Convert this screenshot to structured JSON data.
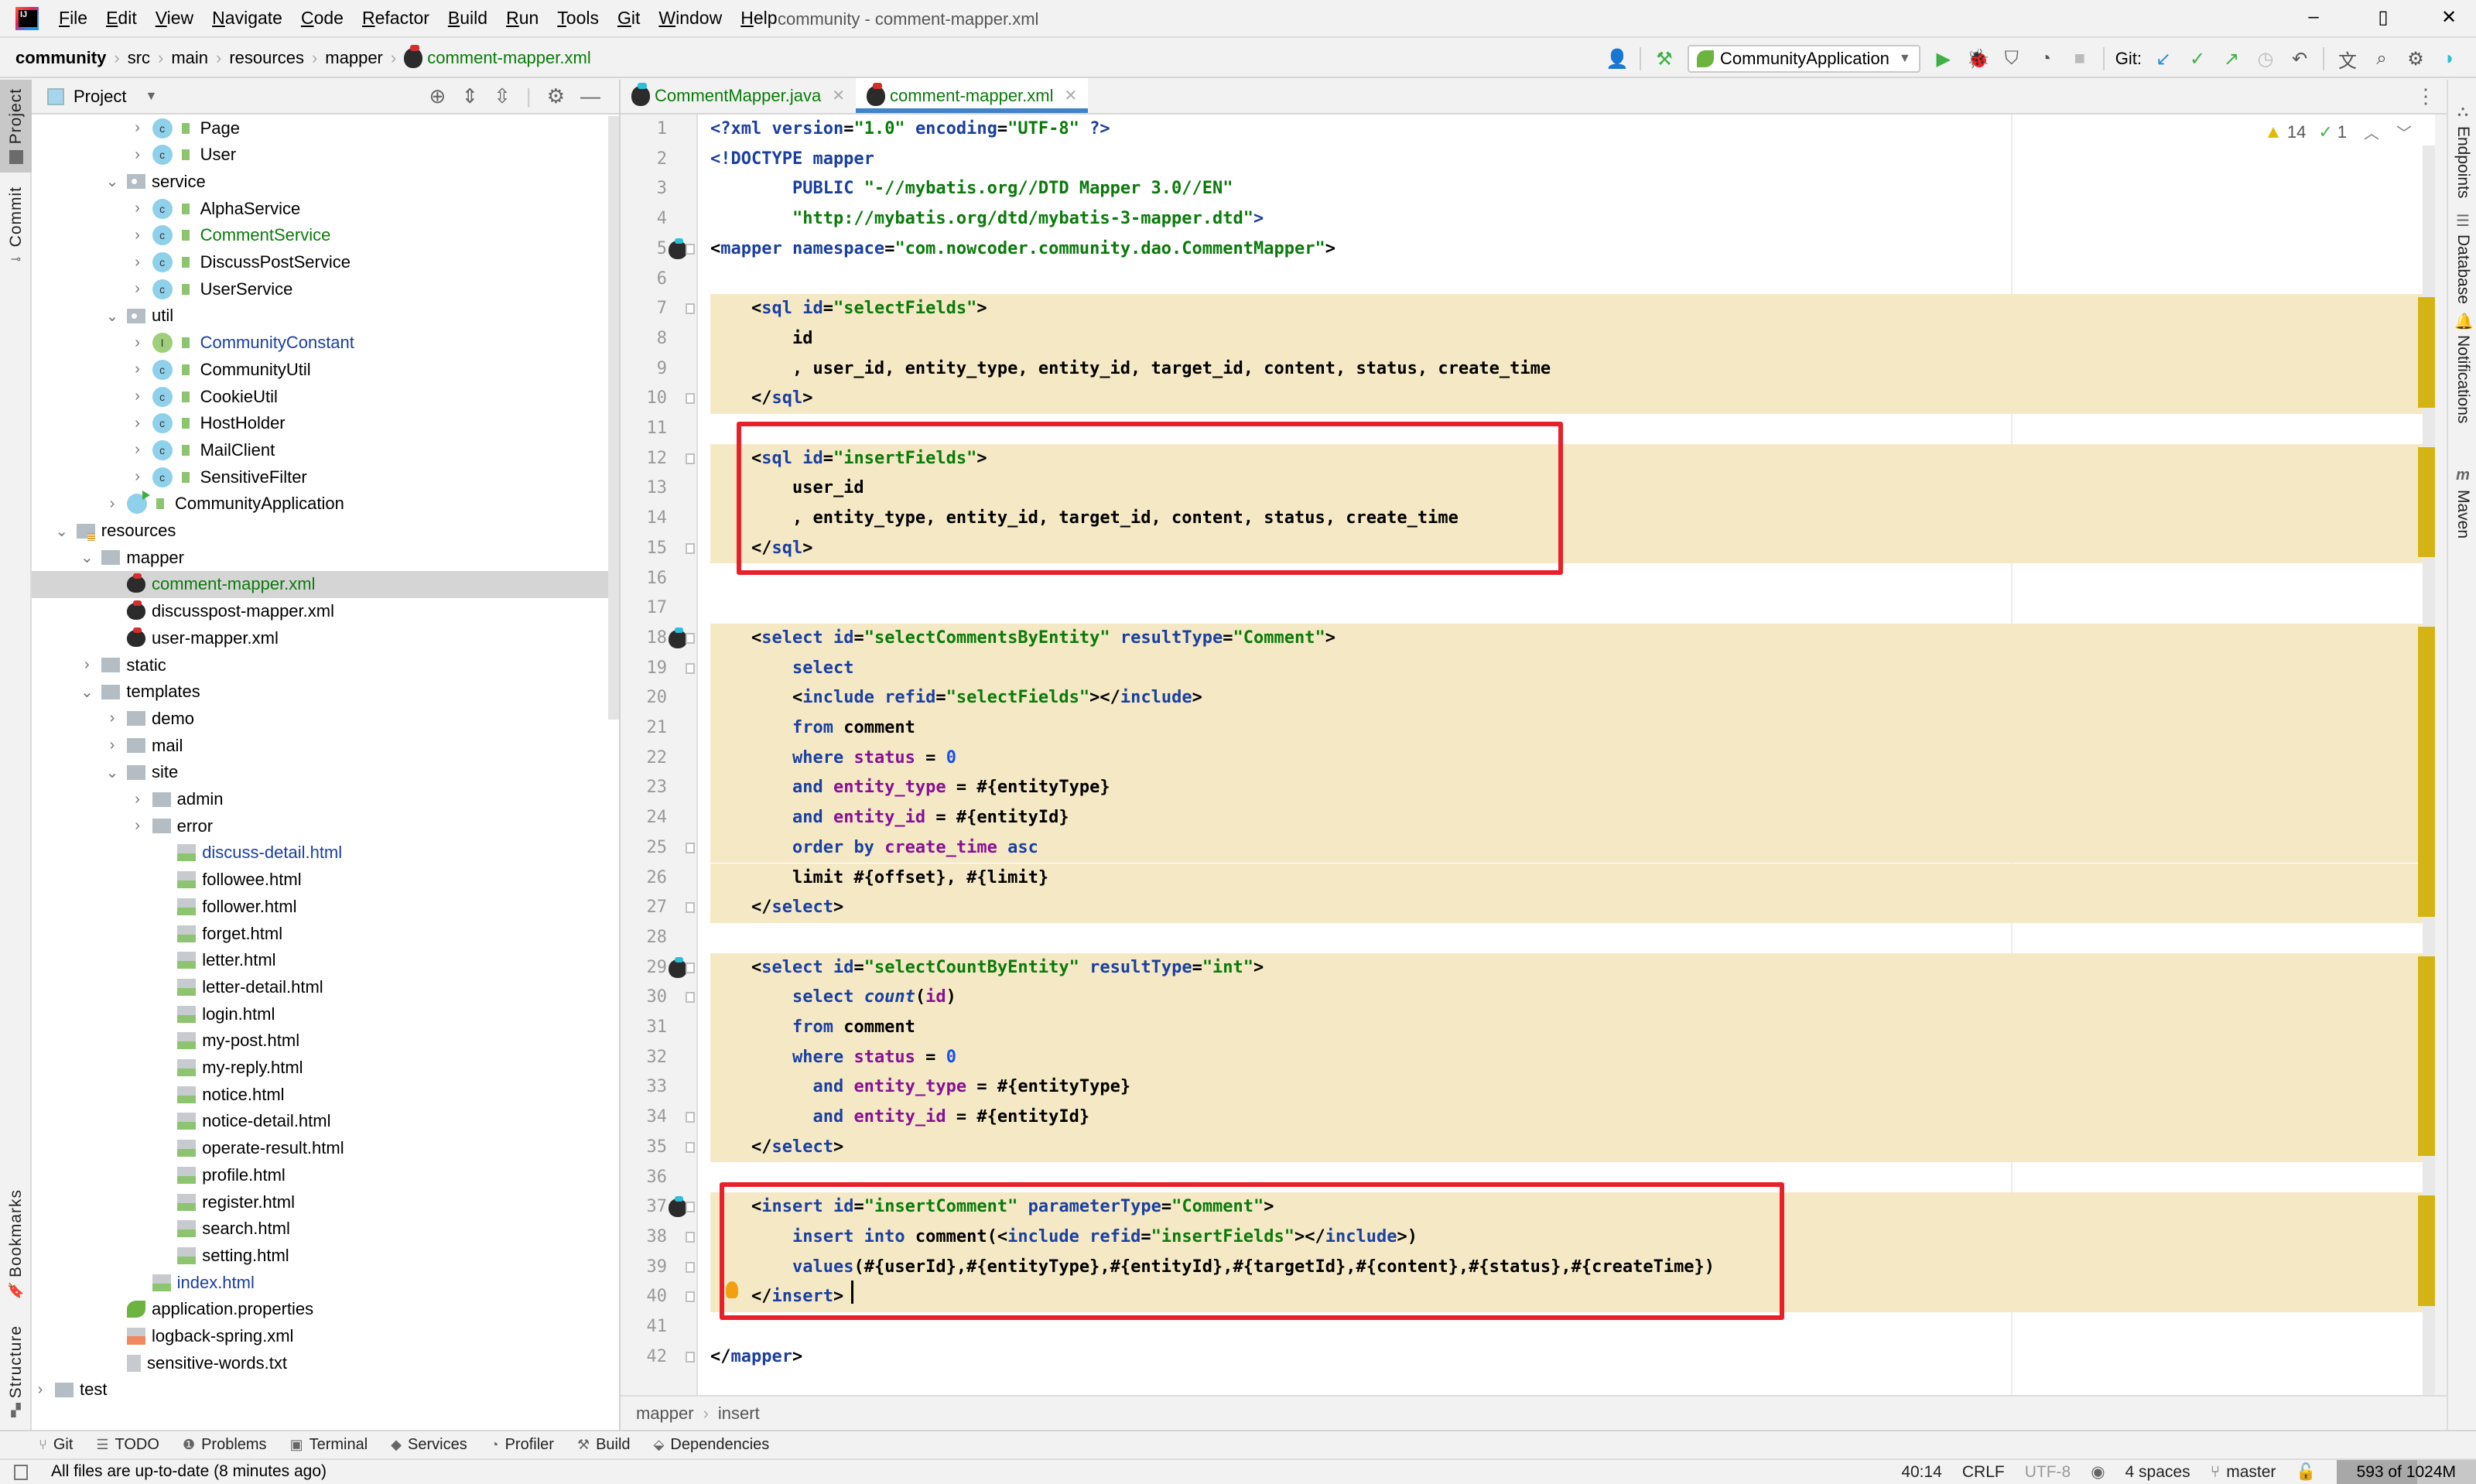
{
  "window": {
    "title": "community - comment-mapper.xml",
    "menu": [
      "File",
      "Edit",
      "View",
      "Navigate",
      "Code",
      "Refactor",
      "Build",
      "Run",
      "Tools",
      "Git",
      "Window",
      "Help"
    ],
    "controls": {
      "minimize": "–",
      "maximize": "▯",
      "close": "✕"
    }
  },
  "breadcrumb": [
    "community",
    "src",
    "main",
    "resources",
    "mapper",
    "comment-mapper.xml"
  ],
  "toolbar": {
    "run_config": "CommunityApplication",
    "git_label": "Git:"
  },
  "left_strip": {
    "tabs": [
      "Project",
      "Commit",
      "Bookmarks",
      "Structure"
    ]
  },
  "right_strip": {
    "tabs": [
      "Endpoints",
      "Database",
      "Notifications",
      "Maven"
    ]
  },
  "project_panel": {
    "title": "Project",
    "tree": [
      {
        "label": "Page",
        "type": "class",
        "depth": 6,
        "chev": "›"
      },
      {
        "label": "User",
        "type": "class",
        "depth": 6,
        "chev": "›"
      },
      {
        "label": "service",
        "type": "pkg",
        "depth": 5,
        "chev": "⌄"
      },
      {
        "label": "AlphaService",
        "type": "class",
        "depth": 6,
        "chev": "›"
      },
      {
        "label": "CommentService",
        "type": "class",
        "depth": 6,
        "chev": "›",
        "color": "green"
      },
      {
        "label": "DiscussPostService",
        "type": "class",
        "depth": 6,
        "chev": "›"
      },
      {
        "label": "UserService",
        "type": "class",
        "depth": 6,
        "chev": "›"
      },
      {
        "label": "util",
        "type": "pkg",
        "depth": 5,
        "chev": "⌄"
      },
      {
        "label": "CommunityConstant",
        "type": "iface",
        "depth": 6,
        "chev": "›",
        "color": "blue"
      },
      {
        "label": "CommunityUtil",
        "type": "class",
        "depth": 6,
        "chev": "›"
      },
      {
        "label": "CookieUtil",
        "type": "class",
        "depth": 6,
        "chev": "›"
      },
      {
        "label": "HostHolder",
        "type": "class",
        "depth": 6,
        "chev": "›"
      },
      {
        "label": "MailClient",
        "type": "class",
        "depth": 6,
        "chev": "›"
      },
      {
        "label": "SensitiveFilter",
        "type": "class",
        "depth": 6,
        "chev": "›"
      },
      {
        "label": "CommunityApplication",
        "type": "app",
        "depth": 5,
        "chev": "›"
      },
      {
        "label": "resources",
        "type": "resfolder",
        "depth": 3,
        "chev": "⌄"
      },
      {
        "label": "mapper",
        "type": "folder",
        "depth": 4,
        "chev": "⌄"
      },
      {
        "label": "comment-mapper.xml",
        "type": "xmlfile",
        "depth": 5,
        "chev": "",
        "color": "green",
        "selected": true
      },
      {
        "label": "discusspost-mapper.xml",
        "type": "xmlfile",
        "depth": 5,
        "chev": ""
      },
      {
        "label": "user-mapper.xml",
        "type": "xmlfile",
        "depth": 5,
        "chev": ""
      },
      {
        "label": "static",
        "type": "folder",
        "depth": 4,
        "chev": "›"
      },
      {
        "label": "templates",
        "type": "folder",
        "depth": 4,
        "chev": "⌄"
      },
      {
        "label": "demo",
        "type": "folder",
        "depth": 5,
        "chev": "›"
      },
      {
        "label": "mail",
        "type": "folder",
        "depth": 5,
        "chev": "›"
      },
      {
        "label": "site",
        "type": "folder",
        "depth": 5,
        "chev": "⌄"
      },
      {
        "label": "admin",
        "type": "folder",
        "depth": 6,
        "chev": "›"
      },
      {
        "label": "error",
        "type": "folder",
        "depth": 6,
        "chev": "›"
      },
      {
        "label": "discuss-detail.html",
        "type": "html",
        "depth": 7,
        "chev": "",
        "color": "blue"
      },
      {
        "label": "followee.html",
        "type": "html",
        "depth": 7,
        "chev": ""
      },
      {
        "label": "follower.html",
        "type": "html",
        "depth": 7,
        "chev": ""
      },
      {
        "label": "forget.html",
        "type": "html",
        "depth": 7,
        "chev": ""
      },
      {
        "label": "letter.html",
        "type": "html",
        "depth": 7,
        "chev": ""
      },
      {
        "label": "letter-detail.html",
        "type": "html",
        "depth": 7,
        "chev": ""
      },
      {
        "label": "login.html",
        "type": "html",
        "depth": 7,
        "chev": ""
      },
      {
        "label": "my-post.html",
        "type": "html",
        "depth": 7,
        "chev": ""
      },
      {
        "label": "my-reply.html",
        "type": "html",
        "depth": 7,
        "chev": ""
      },
      {
        "label": "notice.html",
        "type": "html",
        "depth": 7,
        "chev": ""
      },
      {
        "label": "notice-detail.html",
        "type": "html",
        "depth": 7,
        "chev": ""
      },
      {
        "label": "operate-result.html",
        "type": "html",
        "depth": 7,
        "chev": ""
      },
      {
        "label": "profile.html",
        "type": "html",
        "depth": 7,
        "chev": ""
      },
      {
        "label": "register.html",
        "type": "html",
        "depth": 7,
        "chev": ""
      },
      {
        "label": "search.html",
        "type": "html",
        "depth": 7,
        "chev": ""
      },
      {
        "label": "setting.html",
        "type": "html",
        "depth": 7,
        "chev": ""
      },
      {
        "label": "index.html",
        "type": "html",
        "depth": 6,
        "chev": "",
        "color": "blue"
      },
      {
        "label": "application.properties",
        "type": "props",
        "depth": 5,
        "chev": ""
      },
      {
        "label": "logback-spring.xml",
        "type": "logxml",
        "depth": 5,
        "chev": ""
      },
      {
        "label": "sensitive-words.txt",
        "type": "txt",
        "depth": 5,
        "chev": ""
      },
      {
        "label": "test",
        "type": "folder",
        "depth": 2,
        "chev": "›"
      }
    ]
  },
  "editor": {
    "tabs": [
      {
        "label": "CommentMapper.java",
        "active": false
      },
      {
        "label": "comment-mapper.xml",
        "active": true
      }
    ],
    "inspection": {
      "warnings": "14",
      "typos": "1"
    },
    "lines": [
      [
        [
          "pi",
          "<?"
        ],
        [
          "pi",
          "xml "
        ],
        [
          "attr",
          "version"
        ],
        [
          "txt",
          "="
        ],
        [
          "str",
          "\"1.0\""
        ],
        [
          "txt",
          " "
        ],
        [
          "attr",
          "encoding"
        ],
        [
          "txt",
          "="
        ],
        [
          "str",
          "\"UTF-8\""
        ],
        [
          "txt",
          " "
        ],
        [
          "pi",
          "?>"
        ]
      ],
      [
        [
          "tag",
          "<!DOCTYPE mapper"
        ]
      ],
      [
        [
          "txt",
          "        "
        ],
        [
          "tag",
          "PUBLIC "
        ],
        [
          "str",
          "\"-//mybatis.org//DTD Mapper 3.0//EN\""
        ]
      ],
      [
        [
          "txt",
          "        "
        ],
        [
          "str",
          "\"http://mybatis.org/dtd/mybatis-3-mapper.dtd\""
        ],
        [
          "tag",
          ">"
        ]
      ],
      [
        [
          "txt",
          "<"
        ],
        [
          "tag",
          "mapper "
        ],
        [
          "attr",
          "namespace"
        ],
        [
          "txt",
          "="
        ],
        [
          "str",
          "\"com.nowcoder.community.dao.CommentMapper\""
        ],
        [
          "txt",
          ">"
        ]
      ],
      [],
      [
        [
          "txt",
          "    <"
        ],
        [
          "tag",
          "sql "
        ],
        [
          "attr",
          "id"
        ],
        [
          "txt",
          "="
        ],
        [
          "str",
          "\"selectFields\""
        ],
        [
          "txt",
          ">"
        ]
      ],
      [
        [
          "txt",
          "        id"
        ]
      ],
      [
        [
          "txt",
          "        , user_id, entity_type, entity_id, target_id, content, status, create_time"
        ]
      ],
      [
        [
          "txt",
          "    </"
        ],
        [
          "tag",
          "sql"
        ],
        [
          "txt",
          ">"
        ]
      ],
      [],
      [
        [
          "txt",
          "    <"
        ],
        [
          "tag",
          "sql "
        ],
        [
          "attr",
          "id"
        ],
        [
          "txt",
          "="
        ],
        [
          "str",
          "\"insertFields\""
        ],
        [
          "txt",
          ">"
        ]
      ],
      [
        [
          "txt",
          "        user_id"
        ]
      ],
      [
        [
          "txt",
          "        , entity_type, entity_id, target_id, content, status, create_time"
        ]
      ],
      [
        [
          "txt",
          "    </"
        ],
        [
          "tag",
          "sql"
        ],
        [
          "txt",
          ">"
        ]
      ],
      [],
      [],
      [
        [
          "txt",
          "    <"
        ],
        [
          "tag",
          "select "
        ],
        [
          "attr",
          "id"
        ],
        [
          "txt",
          "="
        ],
        [
          "str",
          "\"selectCommentsByEntity\""
        ],
        [
          "txt",
          " "
        ],
        [
          "attr",
          "resultType"
        ],
        [
          "txt",
          "="
        ],
        [
          "str",
          "\"Comment\""
        ],
        [
          "txt",
          ">"
        ]
      ],
      [
        [
          "txt",
          "        "
        ],
        [
          "kw",
          "select"
        ]
      ],
      [
        [
          "txt",
          "        <"
        ],
        [
          "tag",
          "include "
        ],
        [
          "attr",
          "refid"
        ],
        [
          "txt",
          "="
        ],
        [
          "str",
          "\"selectFields\""
        ],
        [
          "txt",
          "></"
        ],
        [
          "tag",
          "include"
        ],
        [
          "txt",
          ">"
        ]
      ],
      [
        [
          "txt",
          "        "
        ],
        [
          "kw",
          "from "
        ],
        [
          "txt",
          "comment"
        ]
      ],
      [
        [
          "txt",
          "        "
        ],
        [
          "kw",
          "where "
        ],
        [
          "col",
          "status"
        ],
        [
          "txt",
          " = "
        ],
        [
          "num",
          "0"
        ]
      ],
      [
        [
          "txt",
          "        "
        ],
        [
          "kw",
          "and "
        ],
        [
          "col",
          "entity_type"
        ],
        [
          "txt",
          " = #{entityType}"
        ]
      ],
      [
        [
          "txt",
          "        "
        ],
        [
          "kw",
          "and "
        ],
        [
          "col",
          "entity_id"
        ],
        [
          "txt",
          " = #{entityId}"
        ]
      ],
      [
        [
          "txt",
          "        "
        ],
        [
          "kw",
          "order by "
        ],
        [
          "col",
          "create_time "
        ],
        [
          "kw",
          "asc"
        ]
      ],
      [
        [
          "txt",
          "        limit #{offset}, #{limit}"
        ]
      ],
      [
        [
          "txt",
          "    </"
        ],
        [
          "tag",
          "select"
        ],
        [
          "txt",
          ">"
        ]
      ],
      [],
      [
        [
          "txt",
          "    <"
        ],
        [
          "tag",
          "select "
        ],
        [
          "attr",
          "id"
        ],
        [
          "txt",
          "="
        ],
        [
          "str",
          "\"selectCountByEntity\""
        ],
        [
          "txt",
          " "
        ],
        [
          "attr",
          "resultType"
        ],
        [
          "txt",
          "="
        ],
        [
          "str",
          "\"int\""
        ],
        [
          "txt",
          ">"
        ]
      ],
      [
        [
          "txt",
          "        "
        ],
        [
          "kw",
          "select "
        ],
        [
          "fn",
          "count"
        ],
        [
          "txt",
          "("
        ],
        [
          "col",
          "id"
        ],
        [
          "txt",
          ")"
        ]
      ],
      [
        [
          "txt",
          "        "
        ],
        [
          "kw",
          "from "
        ],
        [
          "txt",
          "comment"
        ]
      ],
      [
        [
          "txt",
          "        "
        ],
        [
          "kw",
          "where "
        ],
        [
          "col",
          "status"
        ],
        [
          "txt",
          " = "
        ],
        [
          "num",
          "0"
        ]
      ],
      [
        [
          "txt",
          "          "
        ],
        [
          "kw",
          "and "
        ],
        [
          "col",
          "entity_type"
        ],
        [
          "txt",
          " = #{entityType}"
        ]
      ],
      [
        [
          "txt",
          "          "
        ],
        [
          "kw",
          "and "
        ],
        [
          "col",
          "entity_id"
        ],
        [
          "txt",
          " = #{entityId}"
        ]
      ],
      [
        [
          "txt",
          "    </"
        ],
        [
          "tag",
          "select"
        ],
        [
          "txt",
          ">"
        ]
      ],
      [],
      [
        [
          "txt",
          "    <"
        ],
        [
          "tag",
          "insert "
        ],
        [
          "attr",
          "id"
        ],
        [
          "txt",
          "="
        ],
        [
          "str",
          "\"insertComment\""
        ],
        [
          "txt",
          " "
        ],
        [
          "attr",
          "parameterType"
        ],
        [
          "txt",
          "="
        ],
        [
          "str",
          "\"Comment\""
        ],
        [
          "txt",
          ">"
        ]
      ],
      [
        [
          "txt",
          "        "
        ],
        [
          "kw",
          "insert into "
        ],
        [
          "txt",
          "comment(<"
        ],
        [
          "tag",
          "include "
        ],
        [
          "attr",
          "refid"
        ],
        [
          "txt",
          "="
        ],
        [
          "str",
          "\"insertFields\""
        ],
        [
          "txt",
          "></"
        ],
        [
          "tag",
          "include"
        ],
        [
          "txt",
          ">)"
        ]
      ],
      [
        [
          "txt",
          "        "
        ],
        [
          "kw",
          "values"
        ],
        [
          "txt",
          "(#{userId},#{entityType},#{entityId},#{targetId},#{content},#{status},#{createTime})"
        ]
      ],
      [
        [
          "txt",
          "    </"
        ],
        [
          "tag",
          "insert"
        ],
        [
          "txt",
          ">"
        ]
      ],
      [],
      [
        [
          "txt",
          "</"
        ],
        [
          "tag",
          "mapper"
        ],
        [
          "txt",
          ">"
        ]
      ]
    ],
    "highlighted_lines": [
      7,
      8,
      9,
      10,
      12,
      13,
      14,
      15,
      18,
      19,
      20,
      21,
      22,
      23,
      24,
      25,
      26,
      27,
      29,
      30,
      31,
      32,
      33,
      34,
      35,
      37,
      38,
      39,
      40
    ],
    "gutter_icons": [
      5,
      18,
      29,
      37
    ],
    "fold_markers": [
      5,
      7,
      10,
      12,
      15,
      18,
      19,
      25,
      27,
      29,
      30,
      34,
      35,
      37,
      38,
      39,
      40,
      42
    ]
  },
  "editor_breadcrumb": [
    "mapper",
    "insert"
  ],
  "bottom_tools": [
    {
      "label": "Git",
      "icon": "git-icon"
    },
    {
      "label": "TODO",
      "icon": "todo-icon"
    },
    {
      "label": "Problems",
      "icon": "problems-icon"
    },
    {
      "label": "Terminal",
      "icon": "terminal-icon"
    },
    {
      "label": "Services",
      "icon": "services-icon"
    },
    {
      "label": "Profiler",
      "icon": "profiler-icon"
    },
    {
      "label": "Build",
      "icon": "build-icon"
    },
    {
      "label": "Dependencies",
      "icon": "dependencies-icon"
    }
  ],
  "status": {
    "message": "All files are up-to-date (8 minutes ago)",
    "position": "40:14",
    "line_separator": "CRLF",
    "encoding": "UTF-8",
    "indent": "4 spaces",
    "branch": "master",
    "memory": "593 of 1024M",
    "memory_fraction": 0.58
  }
}
